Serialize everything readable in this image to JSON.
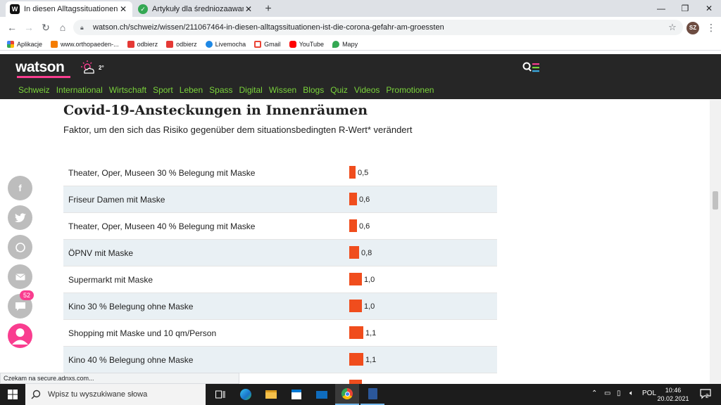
{
  "browser": {
    "tabs": [
      {
        "title": "In diesen Alltagssituationen ist d",
        "active": true
      },
      {
        "title": "Artykuły dla średniozaawansowa",
        "active": false
      }
    ],
    "url": "watson.ch/schweiz/wissen/211067464-in-diesen-alltagssituationen-ist-die-corona-gefahr-am-groessten",
    "profile_initials": "SZ",
    "bookmarks": [
      "Aplikacje",
      "www.orthopaeden-...",
      "odbierz",
      "odbierz",
      "Livemocha",
      "Gmail",
      "YouTube",
      "Mapy"
    ],
    "status_text": "Czekam na secure.adnxs.com..."
  },
  "site": {
    "logo": "watson",
    "temperature": "2°",
    "nav": [
      "Schweiz",
      "International",
      "Wirtschaft",
      "Sport",
      "Leben",
      "Spass",
      "Digital",
      "Wissen",
      "Blogs",
      "Quiz",
      "Videos",
      "Promotionen"
    ]
  },
  "share": {
    "comment_count": "52"
  },
  "chart_data": {
    "type": "bar",
    "title": "Covid-19-Ansteckungen in Innenräumen",
    "subtitle": "Faktor, um den sich das Risiko gegenüber dem situationsbedingten R-Wert* verändert",
    "categories": [
      "Theater, Oper, Museen 30 % Belegung mit Maske",
      "Friseur Damen mit Maske",
      "Theater, Oper, Museen 40 % Belegung mit Maske",
      "ÖPNV mit Maske",
      "Supermarkt mit Maske",
      "Kino 30 % Belegung ohne Maske",
      "Shopping mit Maske und 10 qm/Person",
      "Kino 40 % Belegung ohne Maske"
    ],
    "values": [
      0.5,
      0.6,
      0.6,
      0.8,
      1.0,
      1.0,
      1.1,
      1.1
    ],
    "value_labels": [
      "0,5",
      "0,6",
      "0,6",
      "0,8",
      "1,0",
      "1,0",
      "1,1",
      "1,1"
    ],
    "bar_color": "#f04d1d"
  },
  "taskbar": {
    "search_placeholder": "Wpisz tu wyszukiwane słowa",
    "language": "POL",
    "time": "10:46",
    "date": "20.02.2021",
    "notifications": "2"
  },
  "colors": {
    "brand_pink": "#f93d8f",
    "nav_green": "#7ad33b",
    "header_bg": "#262626"
  }
}
